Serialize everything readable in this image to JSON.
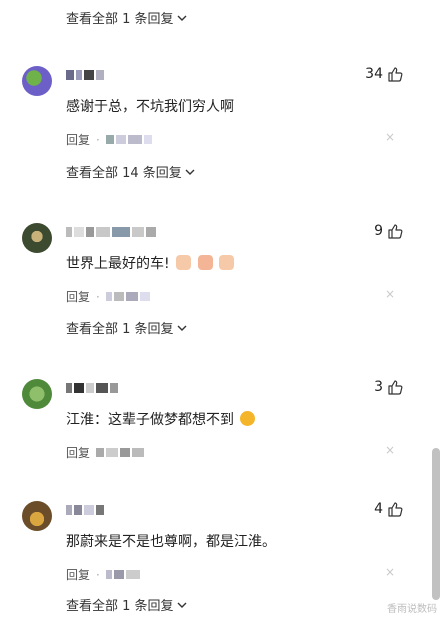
{
  "colors": {
    "text": "#222222",
    "muted": "#555555",
    "close": "#c9c9c9",
    "scrollbar": "#c1c1c1"
  },
  "view_all": [
    {
      "label": "查看全部 1 条回复"
    },
    {
      "label": "查看全部 14 条回复"
    },
    {
      "label": "查看全部 1 条回复"
    },
    {
      "label": "查看全部 1 条回复"
    }
  ],
  "comments": [
    {
      "likes": "34",
      "text": "感谢于总，不坑我们穷人啊",
      "reply_label": "回复",
      "close": "×"
    },
    {
      "likes": "9",
      "text": "世界上最好的车!",
      "reply_label": "回复",
      "close": "×"
    },
    {
      "likes": "3",
      "text": "江淮：这辈子做梦都想不到",
      "reply_label": "回复",
      "close": "×"
    },
    {
      "likes": "4",
      "text": "那蔚来是不是也尊啊，都是江淮。",
      "reply_label": "回复",
      "close": "×"
    }
  ],
  "watermark": "香雨说数码"
}
